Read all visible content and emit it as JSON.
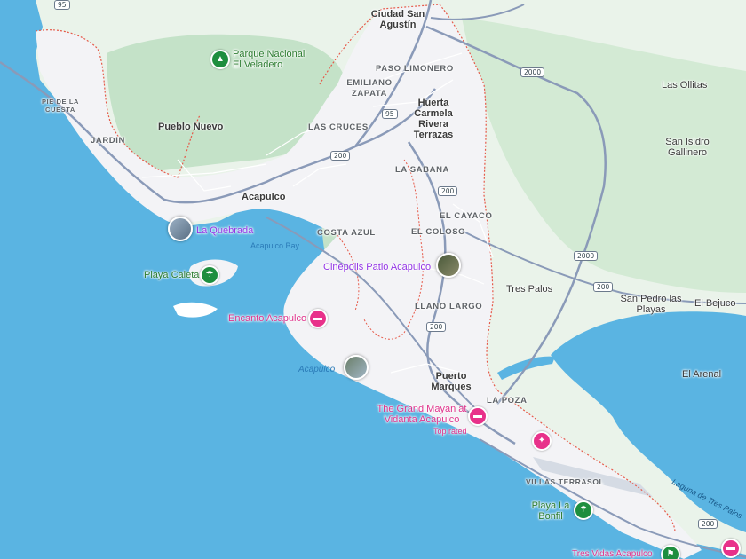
{
  "map": {
    "colors": {
      "sea": "#5ab4e2",
      "lagoon": "#5ab4e2",
      "land": "#e4efe1",
      "forest": "#c4e2c8",
      "urban": "#f3f3f6",
      "road": "#ffffff",
      "highway": "#8a9ab8",
      "boundary": "#e65a4a",
      "airport": "#d5dbe4"
    },
    "labels": {
      "ciudad_san_agustin": "Ciudad San Agustín",
      "parque_veladero": "Parque Nacional El Veladero",
      "paso_limonero": "PASO LIMONERO",
      "emiliano_zapata": "EMILIANO ZAPATA",
      "huerta_carmela": "Huerta Carmela Rivera Terrazas",
      "las_ollitas": "Las Ollitas",
      "pie_de_la_cuesta": "PIE DE LA CUESTA",
      "pueblo_nuevo": "Pueblo Nuevo",
      "las_cruces": "LAS CRUCES",
      "san_isidro_gallinero": "San Isidro Gallinero",
      "jardin": "JARDIN",
      "la_sabana": "LA SABANA",
      "acapulco": "Acapulco",
      "el_cayaco": "EL CAYACO",
      "la_quebrada": "La Quebrada",
      "costa_azul": "COSTA AZUL",
      "el_coloso": "EL COLOSO",
      "acapulco_bay": "Acapulco Bay",
      "cinepolis": "Cinépolis Patio Acapulco",
      "playa_caleta": "Playa Caleta",
      "tres_palos": "Tres Palos",
      "san_pedro_las_playas": "San Pedro las Playas",
      "el_bejuco": "El Bejuco",
      "encanto_acapulco": "Encanto Acapulco",
      "llano_largo": "LLANO LARGO",
      "acapulco_water": "Acapulco",
      "el_arenal": "El Arenal",
      "puerto_marques": "Puerto Marques",
      "la_poza": "LA POZA",
      "grand_mayan": "The Grand Mayan at Vidanta Acapulco",
      "top_rated": "Top rated",
      "laguna_tres_palos": "Laguna de Tres Palos",
      "villas_terrasol": "VILLAS TERRASOL",
      "playa_la_bonfil": "Playa La Bonfil",
      "tres_vidas": "Tres Vidas Acapulco"
    },
    "shields": {
      "s1": "95",
      "s2": "2000",
      "s3": "95",
      "s4": "200",
      "s5": "200",
      "s6": "200",
      "s7": "2000",
      "s8": "200",
      "s9": "200",
      "s10": "200"
    },
    "icons": {
      "park": "tree-icon",
      "beach": "beach-umbrella-icon",
      "hotel": "bed-icon",
      "photo": "photo-thumbnail"
    }
  }
}
